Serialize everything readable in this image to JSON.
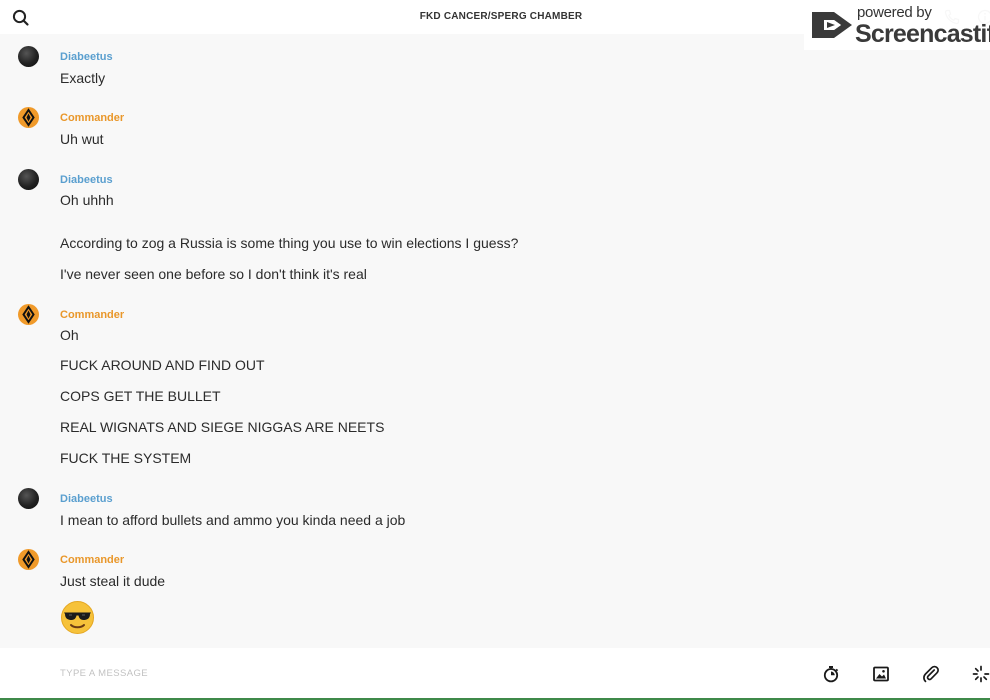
{
  "header": {
    "title": "FKD CANCER/SPERG CHAMBER"
  },
  "watermark": {
    "powered": "powered by",
    "brand": "Screencastify"
  },
  "messages": [
    {
      "author": "Diabeetus",
      "avatar": "dark-orb",
      "lines": [
        "Exactly"
      ]
    },
    {
      "author": "Commander",
      "avatar": "orange-emblem",
      "lines": [
        "Uh wut"
      ]
    },
    {
      "author": "Diabeetus",
      "avatar": "dark-orb",
      "lines": [
        "Oh uhhh",
        "According to zog a Russia is some thing you use to win elections I guess?",
        "I've never seen one before so I don't think it's real"
      ]
    },
    {
      "author": "Commander",
      "avatar": "orange-emblem",
      "lines": [
        "Oh",
        "FUCK AROUND AND FIND OUT",
        "COPS GET  THE BULLET",
        "REAL WIGNATS AND SIEGE NIGGAS ARE NEETS",
        "FUCK THE SYSTEM"
      ]
    },
    {
      "author": "Diabeetus",
      "avatar": "dark-orb",
      "lines": [
        "I mean to afford bullets and ammo you kinda need a job"
      ]
    },
    {
      "author": "Commander",
      "avatar": "orange-emblem",
      "lines": [
        "Just steal it dude"
      ],
      "emoji": "sunglasses-emoji"
    }
  ],
  "composer": {
    "placeholder": "TYPE A MESSAGE",
    "tools": [
      "timer-icon",
      "image-icon",
      "paperclip-icon",
      "sparkle-icon"
    ]
  },
  "colors": {
    "author_diabeetus": "#5a9fcf",
    "author_commander": "#e9972a",
    "background": "#f8f8f8",
    "bottom_accent": "#3f8a4a"
  }
}
